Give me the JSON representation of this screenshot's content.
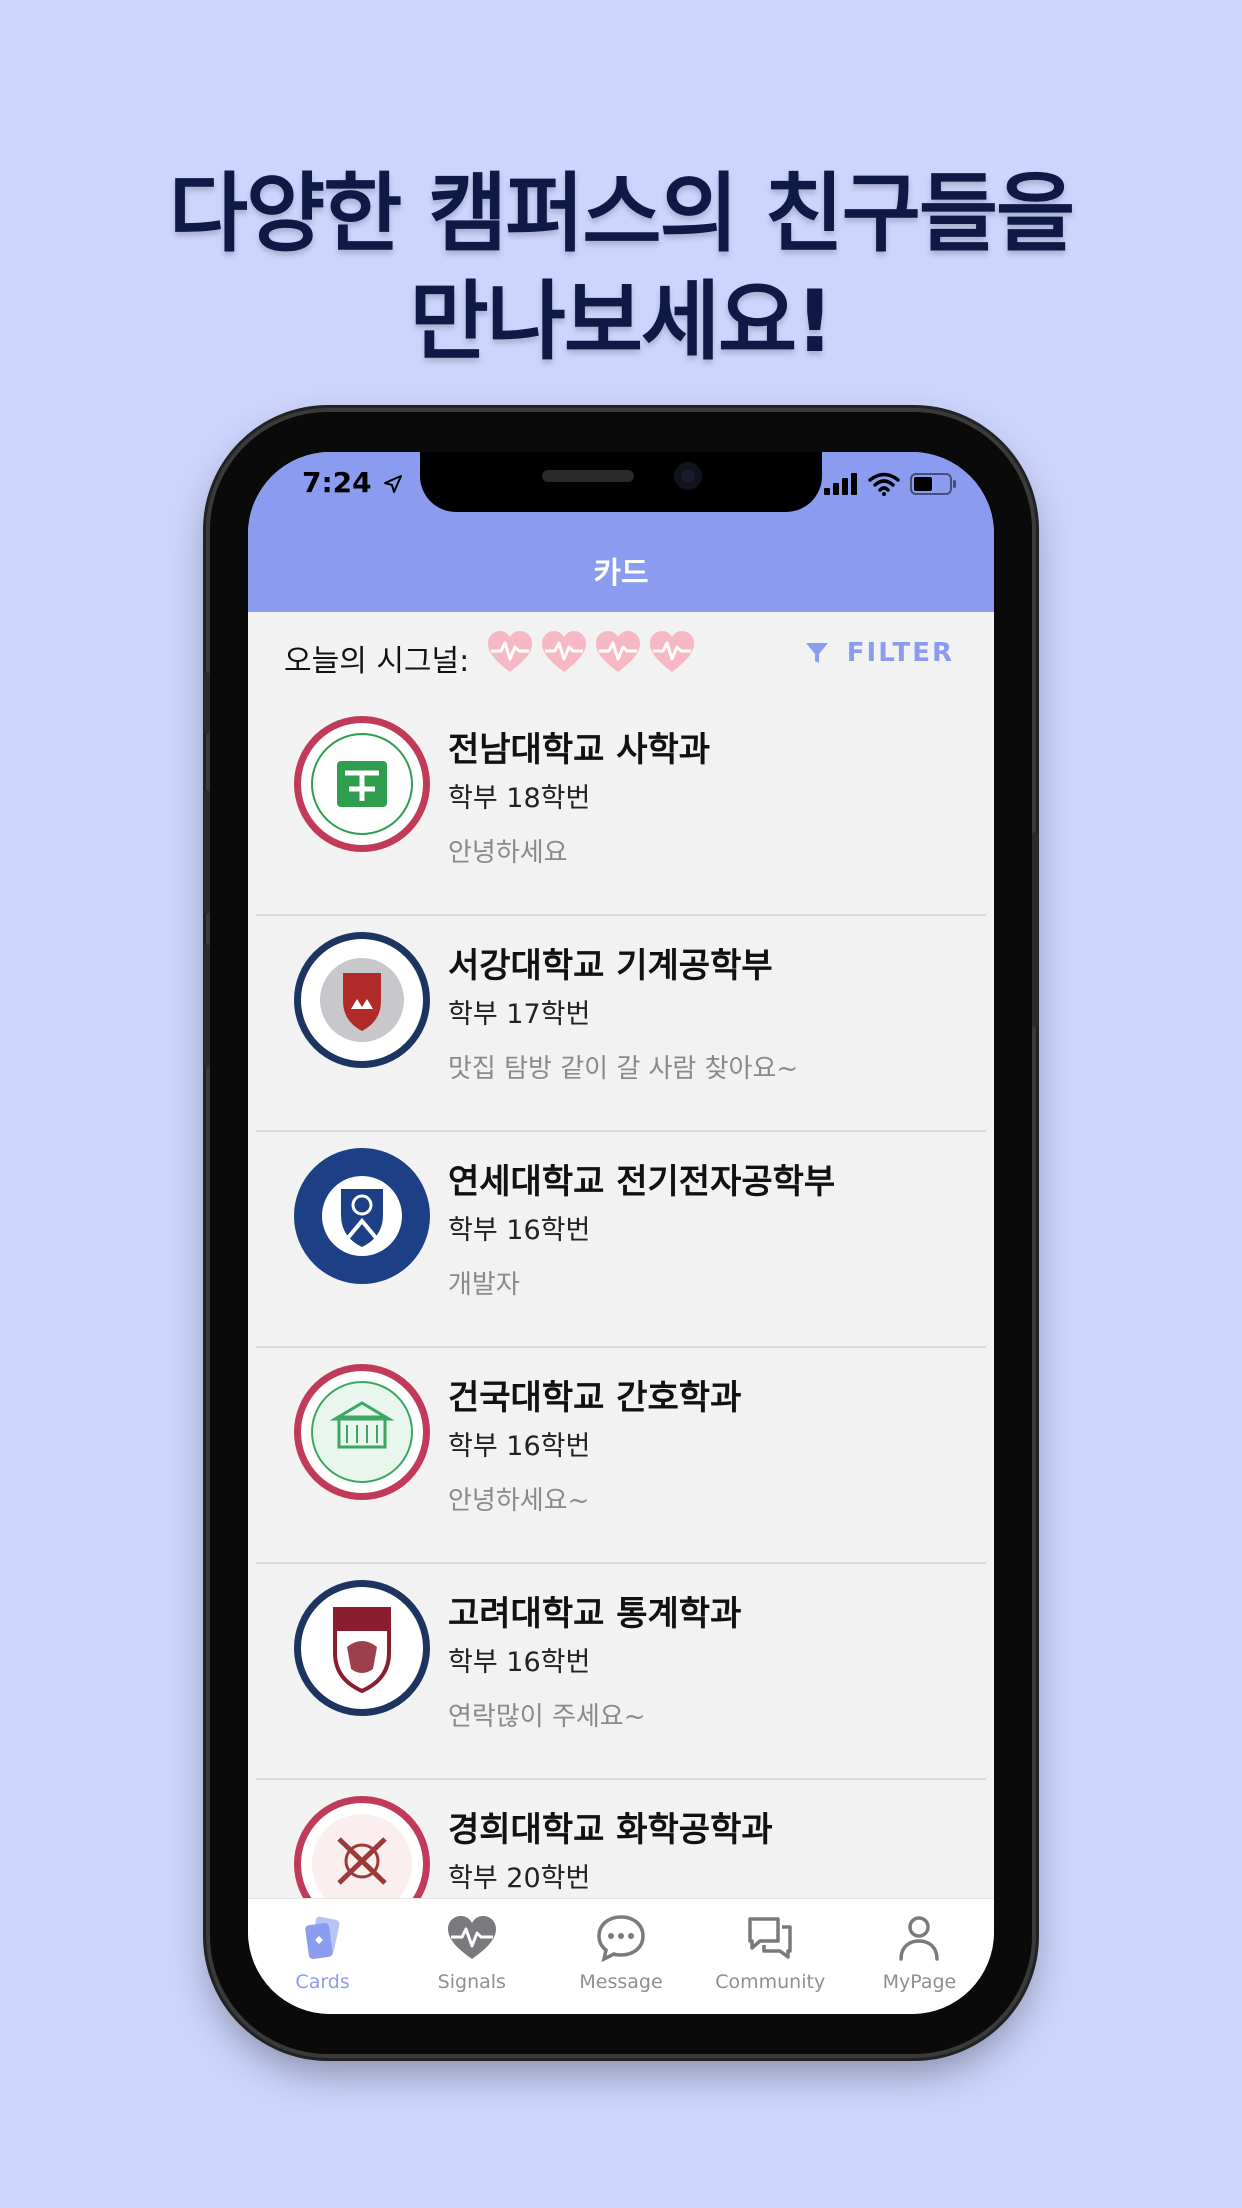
{
  "headline": {
    "line1": "다양한 캠퍼스의 친구들을",
    "line2": "만나보세요!"
  },
  "status_bar": {
    "time": "7:24"
  },
  "nav": {
    "title": "카드"
  },
  "signals": {
    "label": "오늘의 시그널:",
    "hearts_count": 4
  },
  "filter": {
    "label": "FILTER",
    "icon": "filter-icon"
  },
  "cards": [
    {
      "university": "전남대학교 사학과",
      "degree": "학부 18학번",
      "message": "안녕하세요",
      "logo_color": "#c23a5a",
      "logo_inner": "#2e9e4e"
    },
    {
      "university": "서강대학교 기계공학부",
      "degree": "학부 17학번",
      "message": "맛집 탐방 같이 갈 사람 찾아요~",
      "logo_color": "#1d3461",
      "logo_inner": "#b02a2a"
    },
    {
      "university": "연세대학교 전기전자공학부",
      "degree": "학부 16학번",
      "message": "개발자",
      "logo_color": "#1c3f86",
      "logo_inner": "#1c3f86"
    },
    {
      "university": "건국대학교 간호학과",
      "degree": "학부 16학번",
      "message": "안녕하세요~",
      "logo_color": "#c23a5a",
      "logo_inner": "#3aa861"
    },
    {
      "university": "고려대학교 통계학과",
      "degree": "학부 16학번",
      "message": "연락많이 주세요~",
      "logo_color": "#1d3461",
      "logo_inner": "#8b1e2e"
    },
    {
      "university": "경희대학교 화학공학과",
      "degree": "학부 20학번",
      "message": "",
      "logo_color": "#c23a5a",
      "logo_inner": "#9b3a3a"
    }
  ],
  "tabs": [
    {
      "label": "Cards",
      "icon": "cards-icon",
      "active": true
    },
    {
      "label": "Signals",
      "icon": "heartbeat-icon",
      "active": false
    },
    {
      "label": "Message",
      "icon": "chat-bubble-icon",
      "active": false
    },
    {
      "label": "Community",
      "icon": "community-icon",
      "active": false
    },
    {
      "label": "MyPage",
      "icon": "person-icon",
      "active": false
    }
  ],
  "colors": {
    "background": "#cdd5fd",
    "accent": "#8b9cf0",
    "headline": "#0e1a45",
    "heart": "#f5b8c4"
  }
}
